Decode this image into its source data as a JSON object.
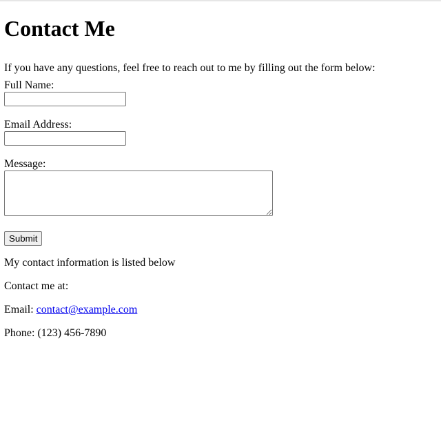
{
  "page": {
    "title": "Contact Me",
    "intro": "If you have any questions, feel free to reach out to me by filling out the form below:"
  },
  "form": {
    "name_label": "Full Name:",
    "name_value": "",
    "email_label": "Email Address:",
    "email_value": "",
    "message_label": "Message:",
    "message_value": "",
    "submit_label": "Submit"
  },
  "contact": {
    "info_text": "My contact information is listed below",
    "contact_at": "Contact me at:",
    "email_prefix": "Email: ",
    "email": "contact@example.com",
    "phone": "Phone: (123) 456-7890"
  },
  "colors": {
    "link": "#0000ee",
    "button_bg": "#efefef",
    "border": "#767676"
  }
}
